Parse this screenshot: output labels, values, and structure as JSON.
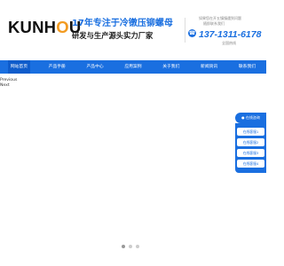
{
  "header": {
    "logo_prefix": "KUNH",
    "logo_accent": "O",
    "logo_suffix": "U",
    "slogan_main": "17年专注于冷镦压铆螺母",
    "slogan_sub": "研发与生产源头实力厂家",
    "hint_line1": "如果您在开五镇镇遇到问题",
    "hint_line2": "随即联系我们",
    "phone": "137-1311-6178",
    "phone_sub": "全国热线"
  },
  "nav": {
    "items": [
      "网站首页",
      "产品手册",
      "产品中心",
      "应用案例",
      "关于我们",
      "新闻资讯",
      "联系我们"
    ]
  },
  "banner": {
    "previous_label": "Previous",
    "next_label": "Next"
  },
  "slider": {
    "dot_count": 3,
    "active_index": 0
  },
  "float_panel": {
    "title": "在线咨询",
    "buttons": [
      "在线客服1",
      "在线客服2",
      "在线客服3",
      "在线客服4"
    ]
  },
  "colors": {
    "brand_blue": "#1a6fe0",
    "logo_orange": "#f29a1f"
  }
}
